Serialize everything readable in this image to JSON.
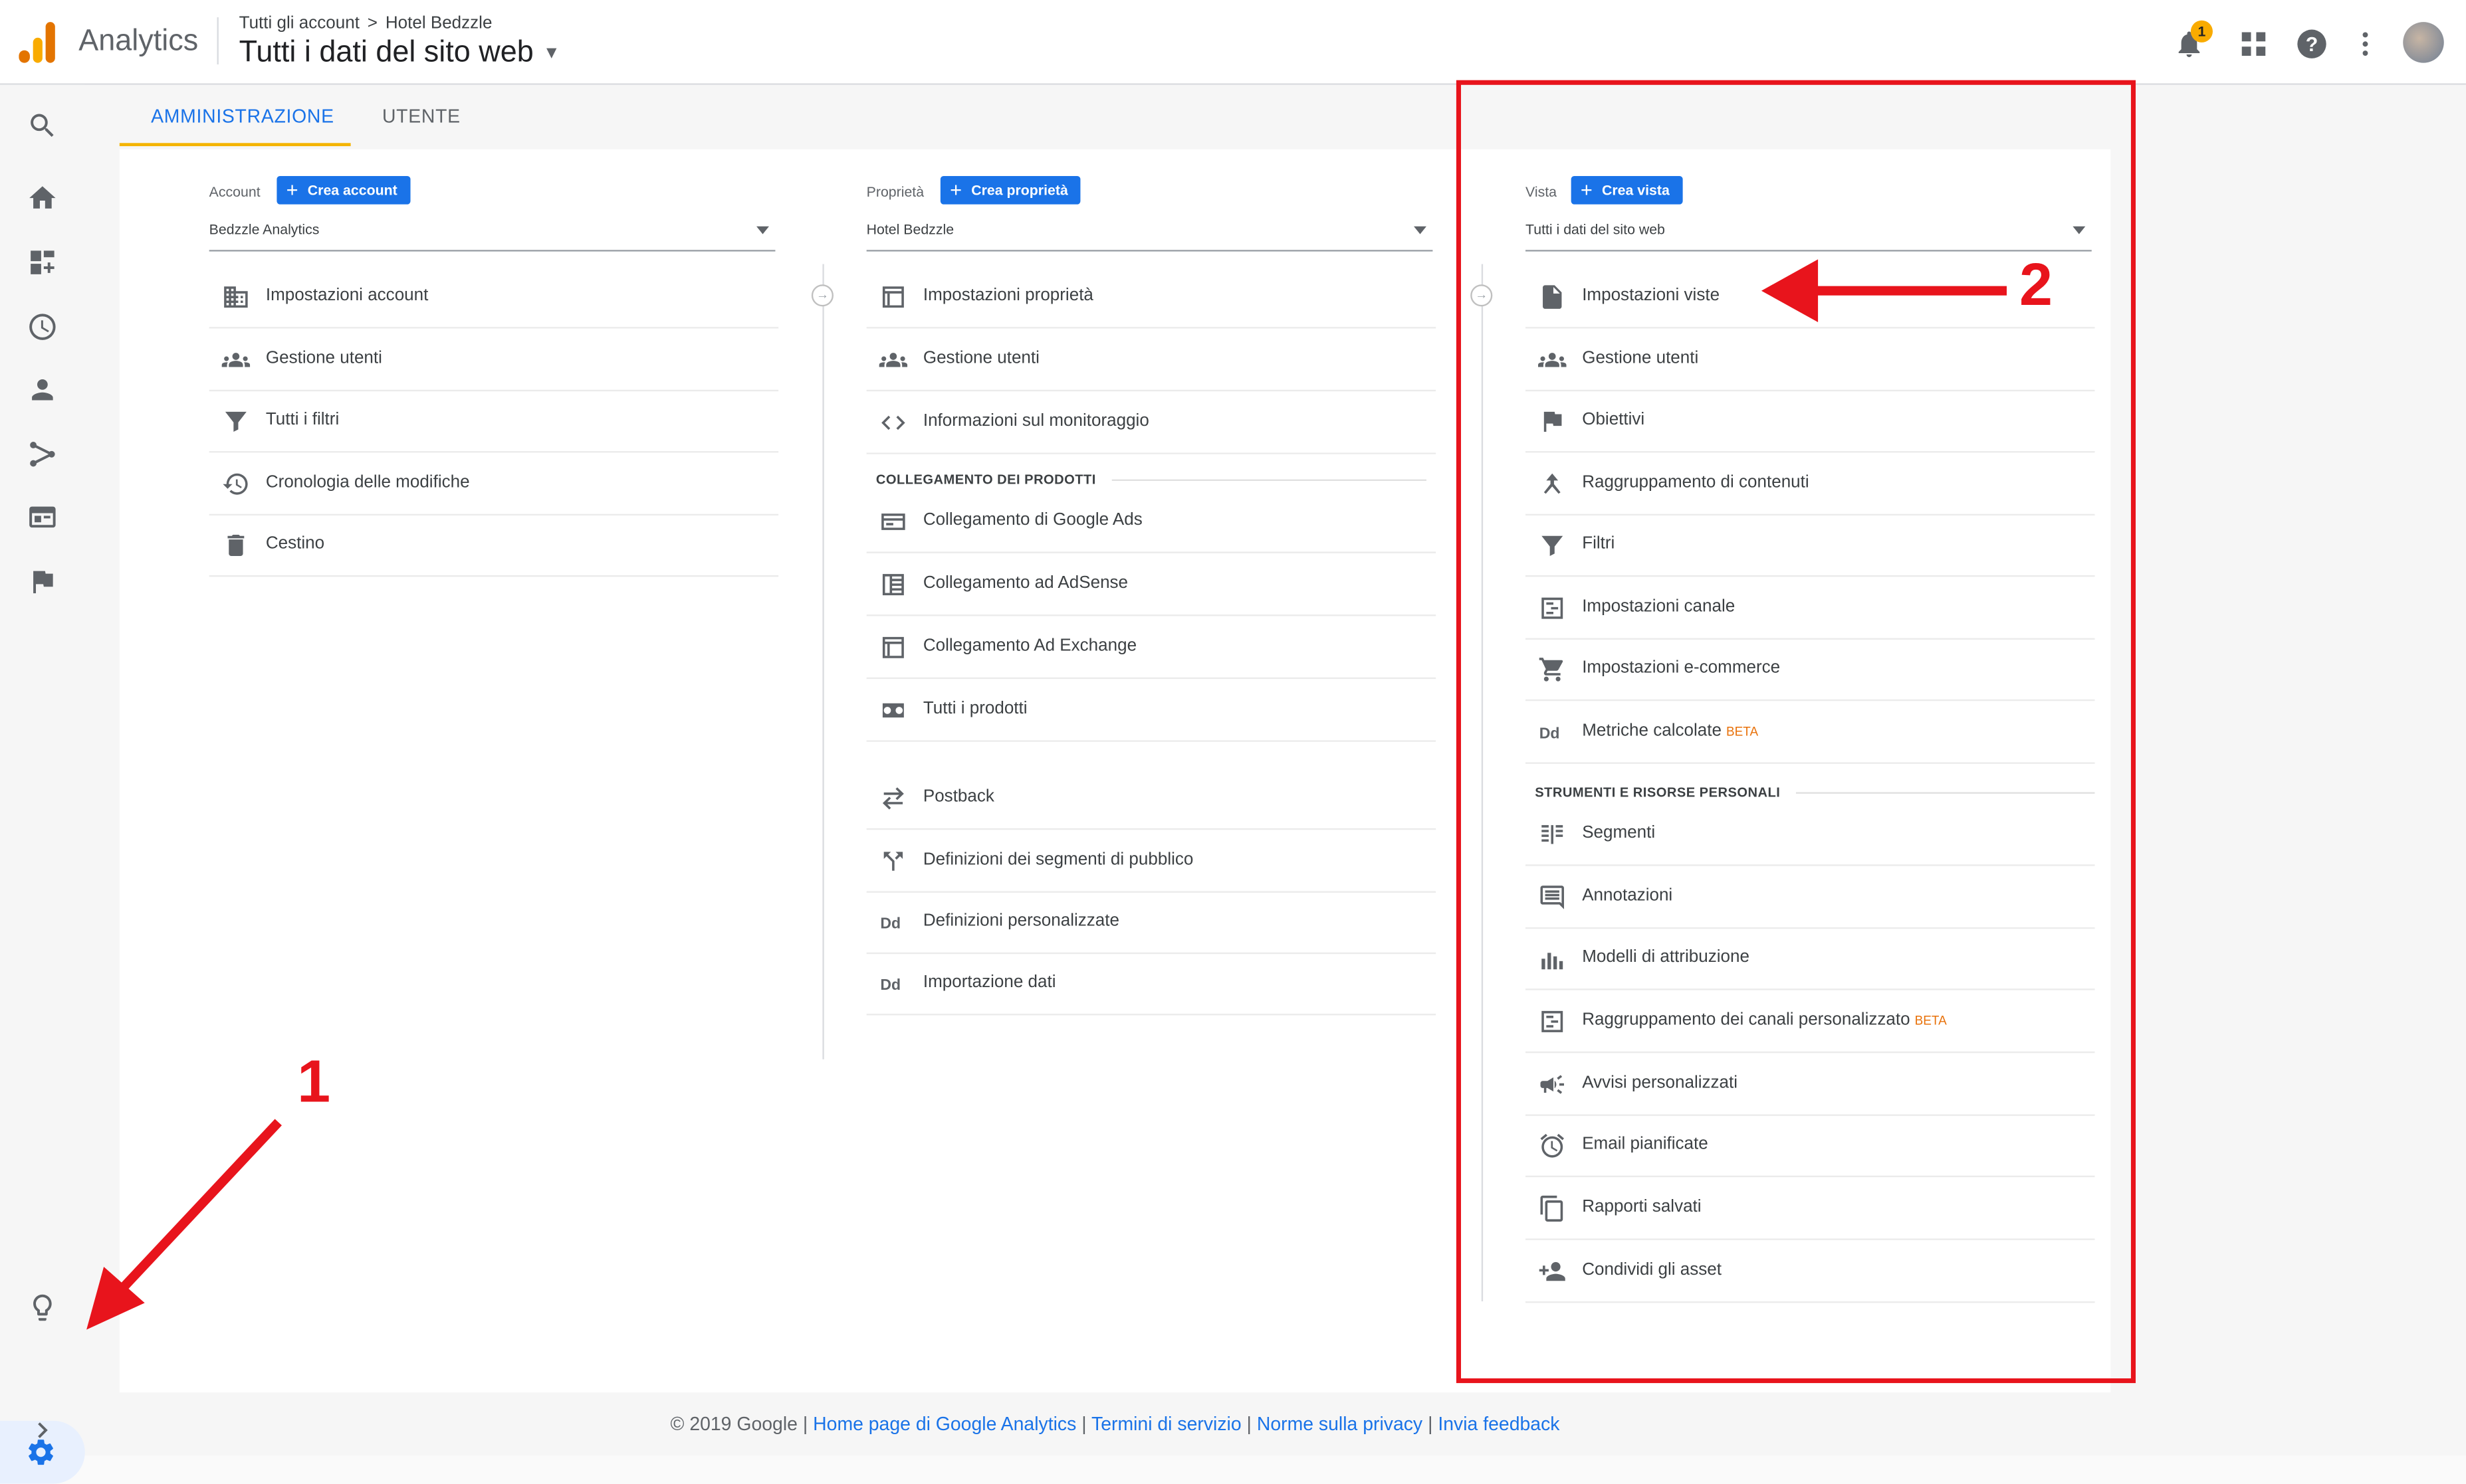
{
  "app": {
    "name": "Analytics"
  },
  "breadcrumb": {
    "account": "Tutti gli account",
    "separator": ">",
    "property": "Hotel Bedzzle"
  },
  "view_title": "Tutti i dati del sito web",
  "header": {
    "notifications_count": "1"
  },
  "tabs": [
    {
      "label": "AMMINISTRAZIONE",
      "active": true
    },
    {
      "label": "UTENTE",
      "active": false
    }
  ],
  "account_col": {
    "header": "Account",
    "create_label": "Crea account",
    "selected": "Bedzzle Analytics",
    "items": [
      {
        "label": "Impostazioni account",
        "icon": "building-icon"
      },
      {
        "label": "Gestione utenti",
        "icon": "users-icon"
      },
      {
        "label": "Tutti i filtri",
        "icon": "filter-icon"
      },
      {
        "label": "Cronologia delle modifiche",
        "icon": "history-icon"
      },
      {
        "label": "Cestino",
        "icon": "trash-icon"
      }
    ]
  },
  "property_col": {
    "header": "Proprietà",
    "create_label": "Crea proprietà",
    "selected": "Hotel Bedzzle",
    "items": [
      {
        "label": "Impostazioni proprietà",
        "icon": "property-icon"
      },
      {
        "label": "Gestione utenti",
        "icon": "users-icon"
      },
      {
        "label": "Informazioni sul monitoraggio",
        "icon": "code-icon"
      }
    ],
    "section_title": "COLLEGAMENTO DEI PRODOTTI",
    "section_items": [
      {
        "label": "Collegamento di Google Ads",
        "icon": "ads-icon"
      },
      {
        "label": "Collegamento ad AdSense",
        "icon": "adsense-icon"
      },
      {
        "label": "Collegamento Ad Exchange",
        "icon": "adexchange-icon"
      },
      {
        "label": "Tutti i prodotti",
        "icon": "products-icon"
      }
    ],
    "extra_items": [
      {
        "label": "Postback",
        "icon": "postback-icon"
      },
      {
        "label": "Definizioni dei segmenti di pubblico",
        "icon": "fork-icon"
      },
      {
        "label": "Definizioni personalizzate",
        "icon": "dd-icon"
      },
      {
        "label": "Importazione dati",
        "icon": "dd-icon"
      }
    ]
  },
  "view_col": {
    "header": "Vista",
    "create_label": "Crea vista",
    "selected": "Tutti i dati del sito web",
    "items": [
      {
        "label": "Impostazioni viste",
        "icon": "document-icon"
      },
      {
        "label": "Gestione utenti",
        "icon": "users-icon"
      },
      {
        "label": "Obiettivi",
        "icon": "flag-icon"
      },
      {
        "label": "Raggruppamento di contenuti",
        "icon": "grouping-icon"
      },
      {
        "label": "Filtri",
        "icon": "filter-icon"
      },
      {
        "label": "Impostazioni canale",
        "icon": "channel-icon"
      },
      {
        "label": "Impostazioni e-commerce",
        "icon": "cart-icon"
      },
      {
        "label": "Metriche calcolate",
        "icon": "dd-icon",
        "beta": "BETA"
      }
    ],
    "section_title": "STRUMENTI E RISORSE PERSONALI",
    "section_items": [
      {
        "label": "Segmenti",
        "icon": "segments-icon"
      },
      {
        "label": "Annotazioni",
        "icon": "comment-icon"
      },
      {
        "label": "Modelli di attribuzione",
        "icon": "bar-chart-icon"
      },
      {
        "label": "Raggruppamento dei canali personalizzato",
        "icon": "channel-icon",
        "beta": "BETA"
      },
      {
        "label": "Avvisi personalizzati",
        "icon": "megaphone-icon"
      },
      {
        "label": "Email pianificate",
        "icon": "alarm-icon"
      },
      {
        "label": "Rapporti salvati",
        "icon": "copy-icon"
      },
      {
        "label": "Condividi gli asset",
        "icon": "share-person-icon"
      }
    ]
  },
  "footer": {
    "copyright": "© 2019 Google",
    "sep": "|",
    "links": [
      "Home page di Google Analytics",
      "Termini di servizio",
      "Norme sulla privacy",
      "Invia feedback"
    ]
  },
  "annotations": {
    "label_1": "1",
    "label_2": "2",
    "color": "#e8141c"
  },
  "colors": {
    "accent": "#1a73e8",
    "tab_indicator": "#f4b400",
    "beta": "#e8710a"
  }
}
